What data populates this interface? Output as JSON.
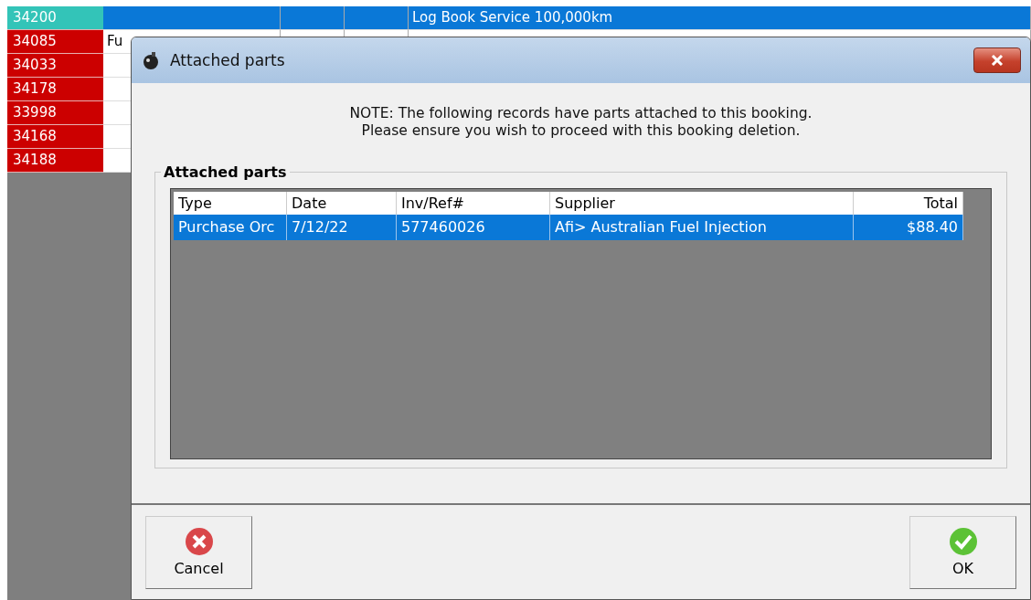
{
  "background_grid": {
    "rows": [
      {
        "id": "34200",
        "color": "#33c4b8",
        "selected": true,
        "cells": [
          "",
          "",
          "",
          "Log Book Service 100,000km"
        ]
      },
      {
        "id": "34085",
        "color": "#cc0000",
        "selected": false,
        "cells": [
          "Fu",
          "",
          "",
          ""
        ]
      },
      {
        "id": "34033",
        "color": "#cc0000",
        "selected": false,
        "cells": [
          "",
          "",
          "",
          ""
        ]
      },
      {
        "id": "34178",
        "color": "#cc0000",
        "selected": false,
        "cells": [
          "",
          "",
          "",
          ""
        ]
      },
      {
        "id": "33998",
        "color": "#cc0000",
        "selected": false,
        "cells": [
          "",
          "",
          "",
          ""
        ]
      },
      {
        "id": "34168",
        "color": "#cc0000",
        "selected": false,
        "cells": [
          "",
          "",
          "",
          ""
        ]
      },
      {
        "id": "34188",
        "color": "#cc0000",
        "selected": false,
        "cells": [
          "",
          "",
          "",
          ""
        ]
      }
    ]
  },
  "dialog": {
    "title": "Attached parts",
    "note": [
      "NOTE: The following records have parts attached to this booking.",
      "Please ensure you wish to proceed with this booking deletion."
    ],
    "group_title": "Attached parts",
    "table": {
      "columns": [
        {
          "label": "Type",
          "kind": "text"
        },
        {
          "label": "Date",
          "kind": "text"
        },
        {
          "label": "Inv/Ref#",
          "kind": "text"
        },
        {
          "label": "Supplier",
          "kind": "text"
        },
        {
          "label": "Total",
          "kind": "amount"
        }
      ],
      "rows": [
        {
          "selected": true,
          "cells": [
            "Purchase Orc",
            "7/12/22",
            "577460026",
            "Afi> Australian Fuel Injection",
            "$88.40"
          ]
        }
      ]
    },
    "buttons": [
      {
        "label": "Cancel",
        "kind": "cancel"
      },
      {
        "label": "OK",
        "kind": "ok"
      }
    ]
  }
}
